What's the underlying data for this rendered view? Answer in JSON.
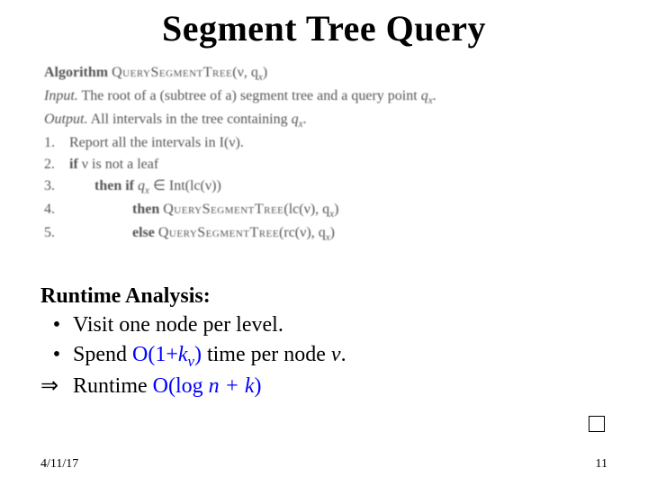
{
  "title": "Segment Tree Query",
  "algorithm": {
    "header_prefix": "Algorithm",
    "header_name": "QuerySegmentTree",
    "header_args": "(ν, q",
    "header_args_sub": "x",
    "header_args_close": ")",
    "input_label": "Input.",
    "input_text": " The root of a (subtree of a) segment tree and a query point ",
    "input_var": "q",
    "input_var_sub": "x",
    "input_end": ".",
    "output_label": "Output.",
    "output_text": " All intervals in the tree containing ",
    "output_var": "q",
    "output_var_sub": "x",
    "output_end": ".",
    "steps": [
      {
        "num": "1.",
        "text": "Report all the intervals in I(ν)."
      },
      {
        "num": "2.",
        "prefix": "if ",
        "mid": "ν is not a leaf"
      },
      {
        "num": "3.",
        "prefix": "then if ",
        "mid_a": "q",
        "mid_sub": "x",
        "mid_b": " ∈ Int(lc(ν))"
      },
      {
        "num": "4.",
        "prefix": "then  ",
        "call": "QuerySegmentTree",
        "args_a": "(lc(ν), q",
        "args_sub": "x",
        "args_b": ")"
      },
      {
        "num": "5.",
        "prefix": "else  ",
        "call": "QuerySegmentTree",
        "args_a": "(rc(ν), q",
        "args_sub": "x",
        "args_b": ")"
      }
    ]
  },
  "analysis": {
    "heading": "Runtime Analysis:",
    "bullet1": "Visit one node per level.",
    "bullet2_a": "Spend ",
    "bullet2_b": "O(1+",
    "bullet2_k": "k",
    "bullet2_v": "v",
    "bullet2_c": ")",
    "bullet2_d": " time per node ",
    "bullet2_e": "v",
    "bullet2_f": ".",
    "arrow": "⇒",
    "runtime_a": "Runtime ",
    "runtime_b": "O(log ",
    "runtime_n": "n",
    "runtime_plus": " + ",
    "runtime_k": "k",
    "runtime_c": ")"
  },
  "footer": {
    "date": "4/11/17",
    "page": "11"
  }
}
